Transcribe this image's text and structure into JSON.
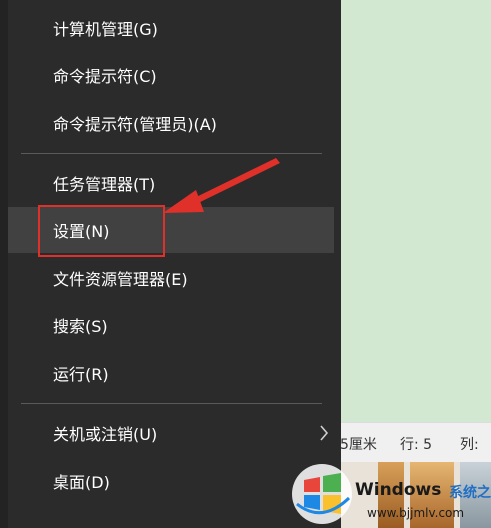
{
  "menu": {
    "items": [
      {
        "label": "计算机管理(G)"
      },
      {
        "label": "命令提示符(C)"
      },
      {
        "label": "命令提示符(管理员)(A)"
      },
      {
        "label": "任务管理器(T)"
      },
      {
        "label": "设置(N)"
      },
      {
        "label": "文件资源管理器(E)"
      },
      {
        "label": "搜索(S)"
      },
      {
        "label": "运行(R)"
      },
      {
        "label": "关机或注销(U)"
      },
      {
        "label": "桌面(D)"
      }
    ],
    "highlighted_item": "设置(N)",
    "submenu_icon": "chevron-right-icon"
  },
  "statusbar": {
    "size_text": "5厘米",
    "line_text": "行: 5",
    "col_text": "列:"
  },
  "watermark": {
    "brand": "Windows",
    "subtitle": "系统之家",
    "url": "www.bjjmlv.com",
    "logo_icon": "windows-logo-icon"
  },
  "colors": {
    "menu_bg": "#2b2b2b",
    "hover_bg": "#414141",
    "annotation": "#e0302a",
    "background": "#d3e8d0"
  }
}
